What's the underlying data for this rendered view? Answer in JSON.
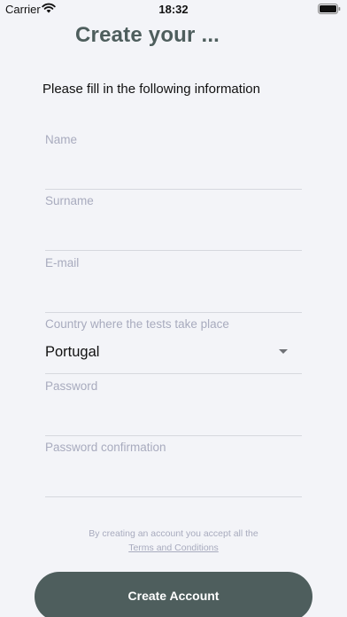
{
  "status_bar": {
    "carrier": "Carrier",
    "time": "18:32"
  },
  "header": {
    "title": "Create your ...",
    "subtitle": "Please fill in the following information"
  },
  "form": {
    "name": {
      "label": "Name",
      "value": ""
    },
    "surname": {
      "label": "Surname",
      "value": ""
    },
    "email": {
      "label": "E-mail",
      "value": ""
    },
    "country": {
      "label": "Country where the tests take place",
      "value": "Portugal"
    },
    "password": {
      "label": "Password",
      "value": ""
    },
    "password_confirmation": {
      "label": "Password confirmation",
      "value": ""
    }
  },
  "terms": {
    "text": "By creating an account you accept all the",
    "link": "Terms and Conditions"
  },
  "actions": {
    "create_label": "Create Account"
  },
  "icons": {
    "wifi": "wifi-icon",
    "battery": "battery-icon",
    "dropdown": "chevron-down-icon"
  },
  "colors": {
    "accent": "#4e5e5d",
    "background": "#f3f4f8",
    "label": "#a8abbe"
  }
}
